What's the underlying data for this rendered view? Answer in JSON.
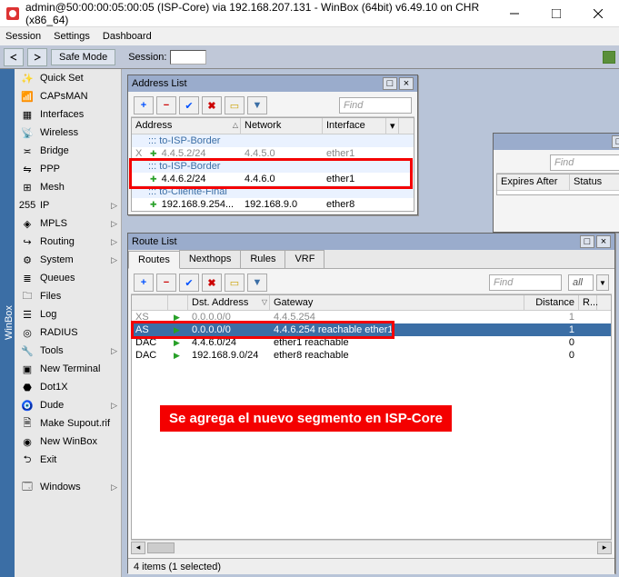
{
  "titlebar": {
    "text": "admin@50:00:00:05:00:05 (ISP-Core) via 192.168.207.131 - WinBox (64bit) v6.49.10 on CHR (x86_64)"
  },
  "menubar": [
    "Session",
    "Settings",
    "Dashboard"
  ],
  "toolbar": {
    "safe_mode": "Safe Mode",
    "session_label": "Session:"
  },
  "sidebar_caption": "WinBox",
  "nav": [
    {
      "icon": "wand",
      "label": "Quick Set"
    },
    {
      "icon": "signal",
      "label": "CAPsMAN"
    },
    {
      "icon": "eth",
      "label": "Interfaces"
    },
    {
      "icon": "wifi",
      "label": "Wireless"
    },
    {
      "icon": "bridge",
      "label": "Bridge"
    },
    {
      "icon": "ppp",
      "label": "PPP"
    },
    {
      "icon": "mesh",
      "label": "Mesh"
    },
    {
      "icon": "ip",
      "label": "IP",
      "chev": true
    },
    {
      "icon": "mpls",
      "label": "MPLS",
      "chev": true
    },
    {
      "icon": "route",
      "label": "Routing",
      "chev": true
    },
    {
      "icon": "sys",
      "label": "System",
      "chev": true
    },
    {
      "icon": "queue",
      "label": "Queues"
    },
    {
      "icon": "files",
      "label": "Files"
    },
    {
      "icon": "log",
      "label": "Log"
    },
    {
      "icon": "radius",
      "label": "RADIUS"
    },
    {
      "icon": "tools",
      "label": "Tools",
      "chev": true
    },
    {
      "icon": "term",
      "label": "New Terminal"
    },
    {
      "icon": "dot1x",
      "label": "Dot1X"
    },
    {
      "icon": "dude",
      "label": "Dude",
      "chev": true
    },
    {
      "icon": "supout",
      "label": "Make Supout.rif"
    },
    {
      "icon": "newwb",
      "label": "New WinBox"
    },
    {
      "icon": "exit",
      "label": "Exit"
    },
    {
      "icon": "windows",
      "label": "Windows",
      "chev": true,
      "section": true
    }
  ],
  "underlay_window": {
    "find_placeholder": "Find",
    "columns": [
      "Expires After",
      "Status"
    ]
  },
  "address_list": {
    "title": "Address List",
    "find_placeholder": "Find",
    "columns": [
      "Address",
      "Network",
      "Interface"
    ],
    "rows": [
      {
        "type": "group",
        "label": "::: to-ISP-Border"
      },
      {
        "type": "row",
        "dim": true,
        "flag": "X",
        "addr": "4.4.5.2/24",
        "net": "4.4.5.0",
        "if": "ether1"
      },
      {
        "type": "group",
        "label": "::: to-ISP-Border"
      },
      {
        "type": "row",
        "addr": "4.4.6.2/24",
        "net": "4.4.6.0",
        "if": "ether1"
      },
      {
        "type": "group",
        "label": "::: to-Cliente-Final"
      },
      {
        "type": "row",
        "addr": "192.168.9.254...",
        "net": "192.168.9.0",
        "if": "ether8"
      }
    ]
  },
  "route_list": {
    "title": "Route List",
    "tabs": [
      "Routes",
      "Nexthops",
      "Rules",
      "VRF"
    ],
    "active_tab": 0,
    "find_placeholder": "Find",
    "all_label": "all",
    "columns": [
      "",
      "",
      "Dst. Address",
      "Gateway",
      "Distance",
      "R..."
    ],
    "rows": [
      {
        "flag": "XS",
        "dim": true,
        "dst": "0.0.0.0/0",
        "gw": "4.4.5.254",
        "dist": "1"
      },
      {
        "flag": "AS",
        "sel": true,
        "dst": "0.0.0.0/0",
        "gw": "4.4.6.254 reachable ether1",
        "dist": "1"
      },
      {
        "flag": "DAC",
        "dst": "4.4.6.0/24",
        "gw": "ether1 reachable",
        "dist": "0"
      },
      {
        "flag": "DAC",
        "dst": "192.168.9.0/24",
        "gw": "ether8 reachable",
        "dist": "0"
      }
    ],
    "status": "4 items (1 selected)"
  },
  "annotation": "Se agrega el nuevo segmento en ISP-Core"
}
